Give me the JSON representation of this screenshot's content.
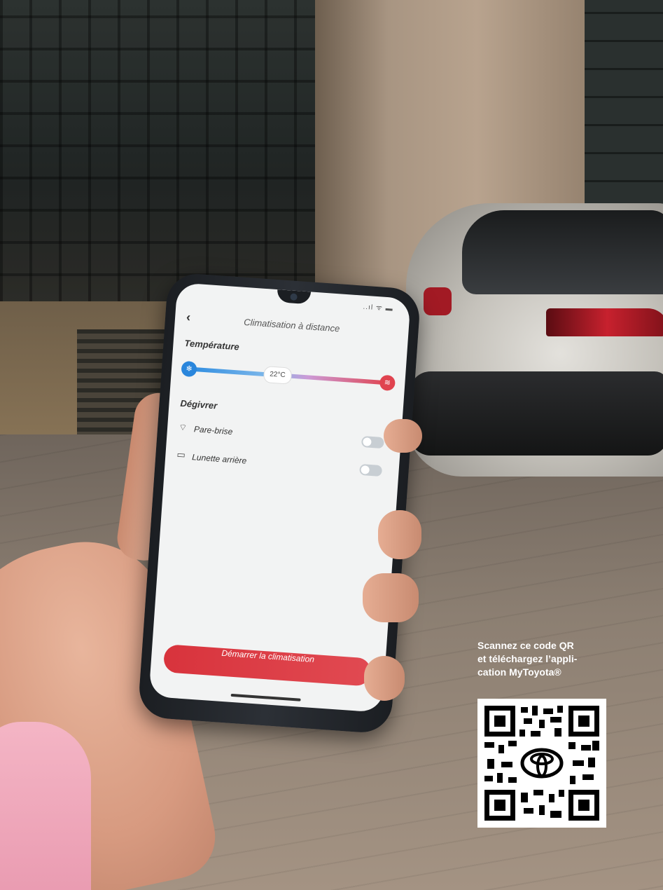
{
  "app": {
    "screen_title": "Climatisation à distance",
    "back_icon": "chevron-left-icon",
    "status_icons": "..ıl ᯤ ▬"
  },
  "temperature": {
    "label": "Température",
    "value": "22°C",
    "level_fraction": 0.45,
    "cold_icon": "snowflake-icon",
    "hot_icon": "heat-icon"
  },
  "defrost": {
    "label": "Dégivrer",
    "items": [
      {
        "label": "Pare-brise",
        "icon": "windshield-icon",
        "enabled": false
      },
      {
        "label": "Lunette arrière",
        "icon": "rear-window-icon",
        "enabled": false
      }
    ]
  },
  "actions": {
    "start_label": "Démarrer la climatisation"
  },
  "promo": {
    "caption_lines": [
      "Scannez ce code QR",
      "et téléchargez l’appli-",
      "cation MyToyota®"
    ]
  },
  "colors": {
    "accent_red": "#e0434f",
    "accent_blue": "#2a86dc"
  }
}
